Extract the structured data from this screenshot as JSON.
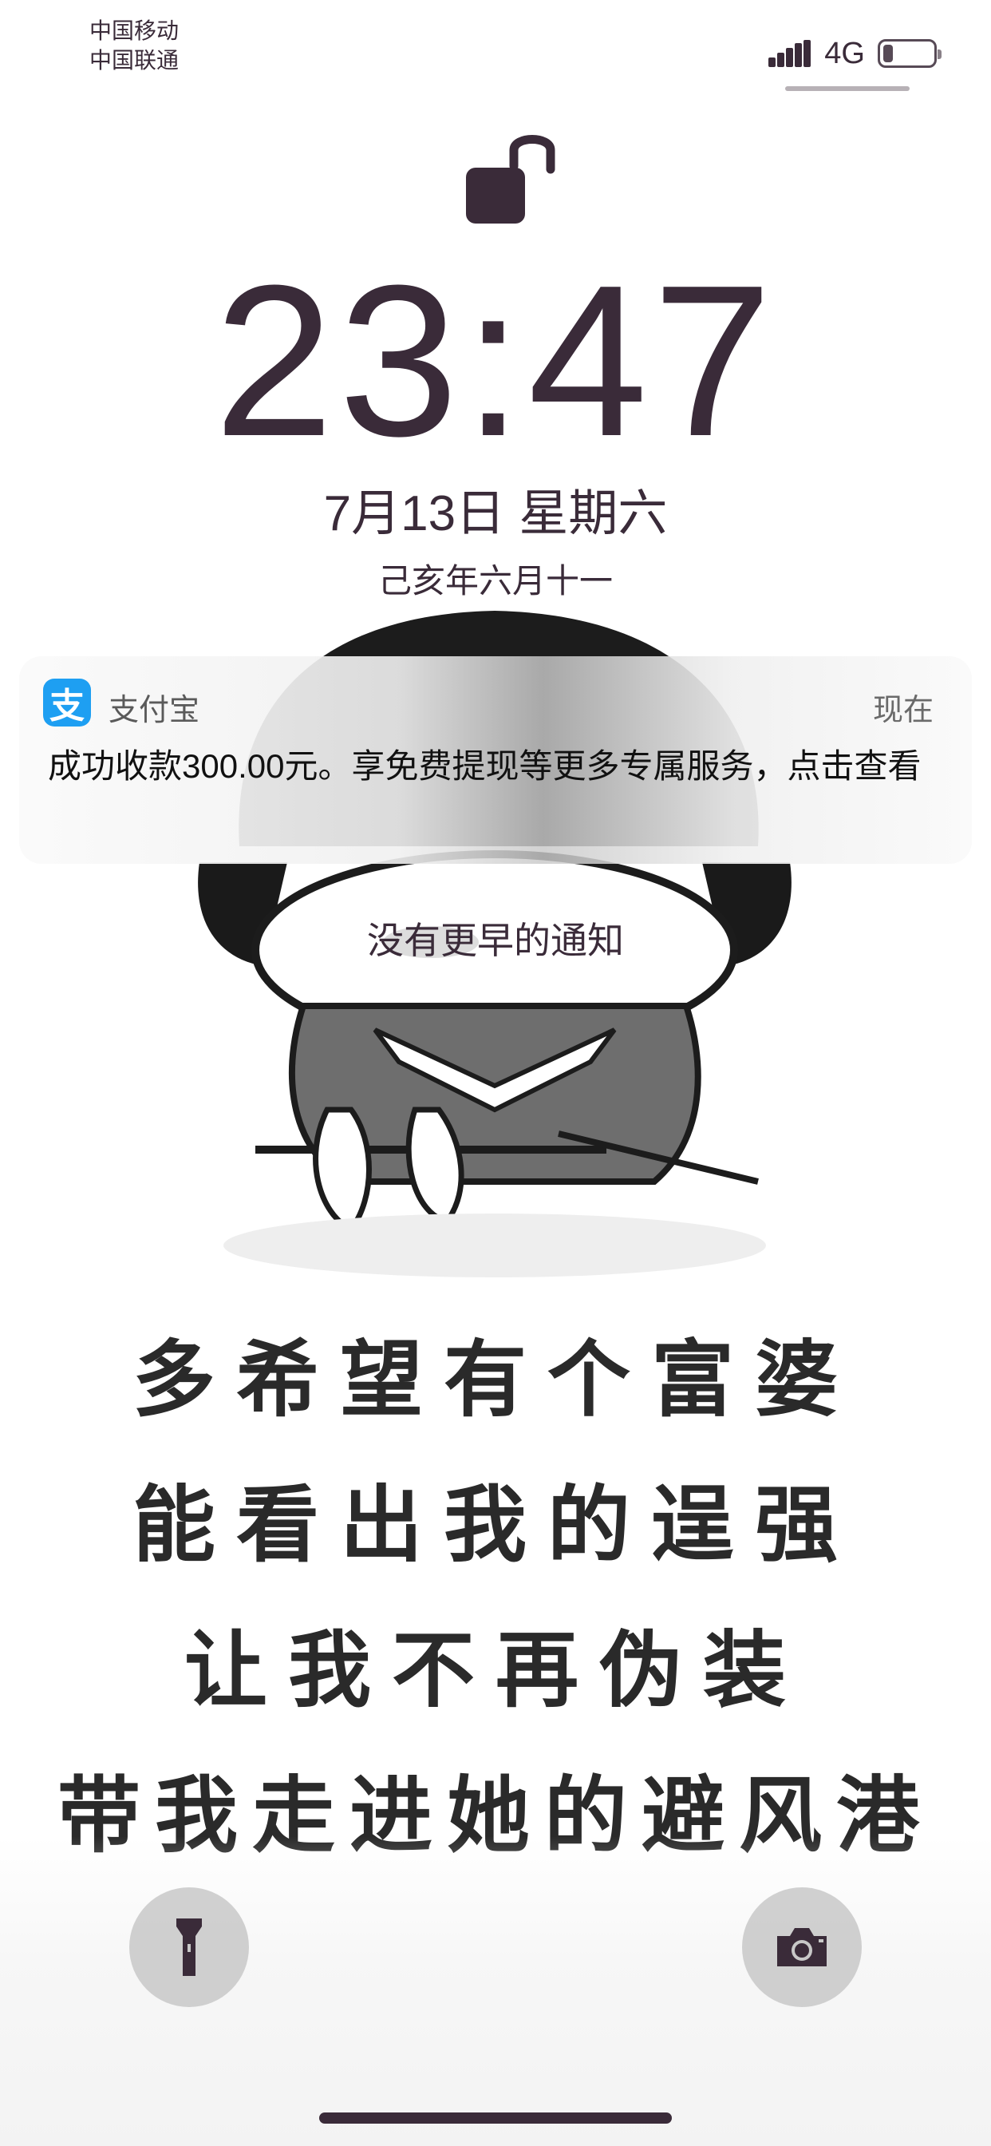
{
  "status_bar": {
    "carrier_1": "中国移动",
    "carrier_2": "中国联通",
    "network": "4G",
    "signal_icon": "signal-bars-icon",
    "battery_icon": "battery-icon",
    "battery_level": 0.2
  },
  "lock": {
    "icon": "unlocked-padlock-icon"
  },
  "clock": {
    "time": "23:47",
    "date": "7月13日 星期六",
    "lunar_date": "己亥年六月十一"
  },
  "notification": {
    "app_icon": "alipay-icon",
    "app_icon_glyph": "支",
    "app_name": "支付宝",
    "time": "现在",
    "body": "成功收款300.00元。享免费提现等更多专属服务，点击查看"
  },
  "notification_center": {
    "no_older": "没有更早的通知"
  },
  "wallpaper": {
    "caption_lines": [
      "多希望有个富婆",
      "能看出我的逞强",
      "让我不再伪装",
      "带我走进她的避风港"
    ]
  },
  "quick_actions": {
    "flashlight_icon": "flashlight-icon",
    "camera_icon": "camera-icon"
  },
  "colors": {
    "foreground": "#3a2b39",
    "alipay_blue": "#1e9ff2",
    "notification_text": "#111111"
  }
}
